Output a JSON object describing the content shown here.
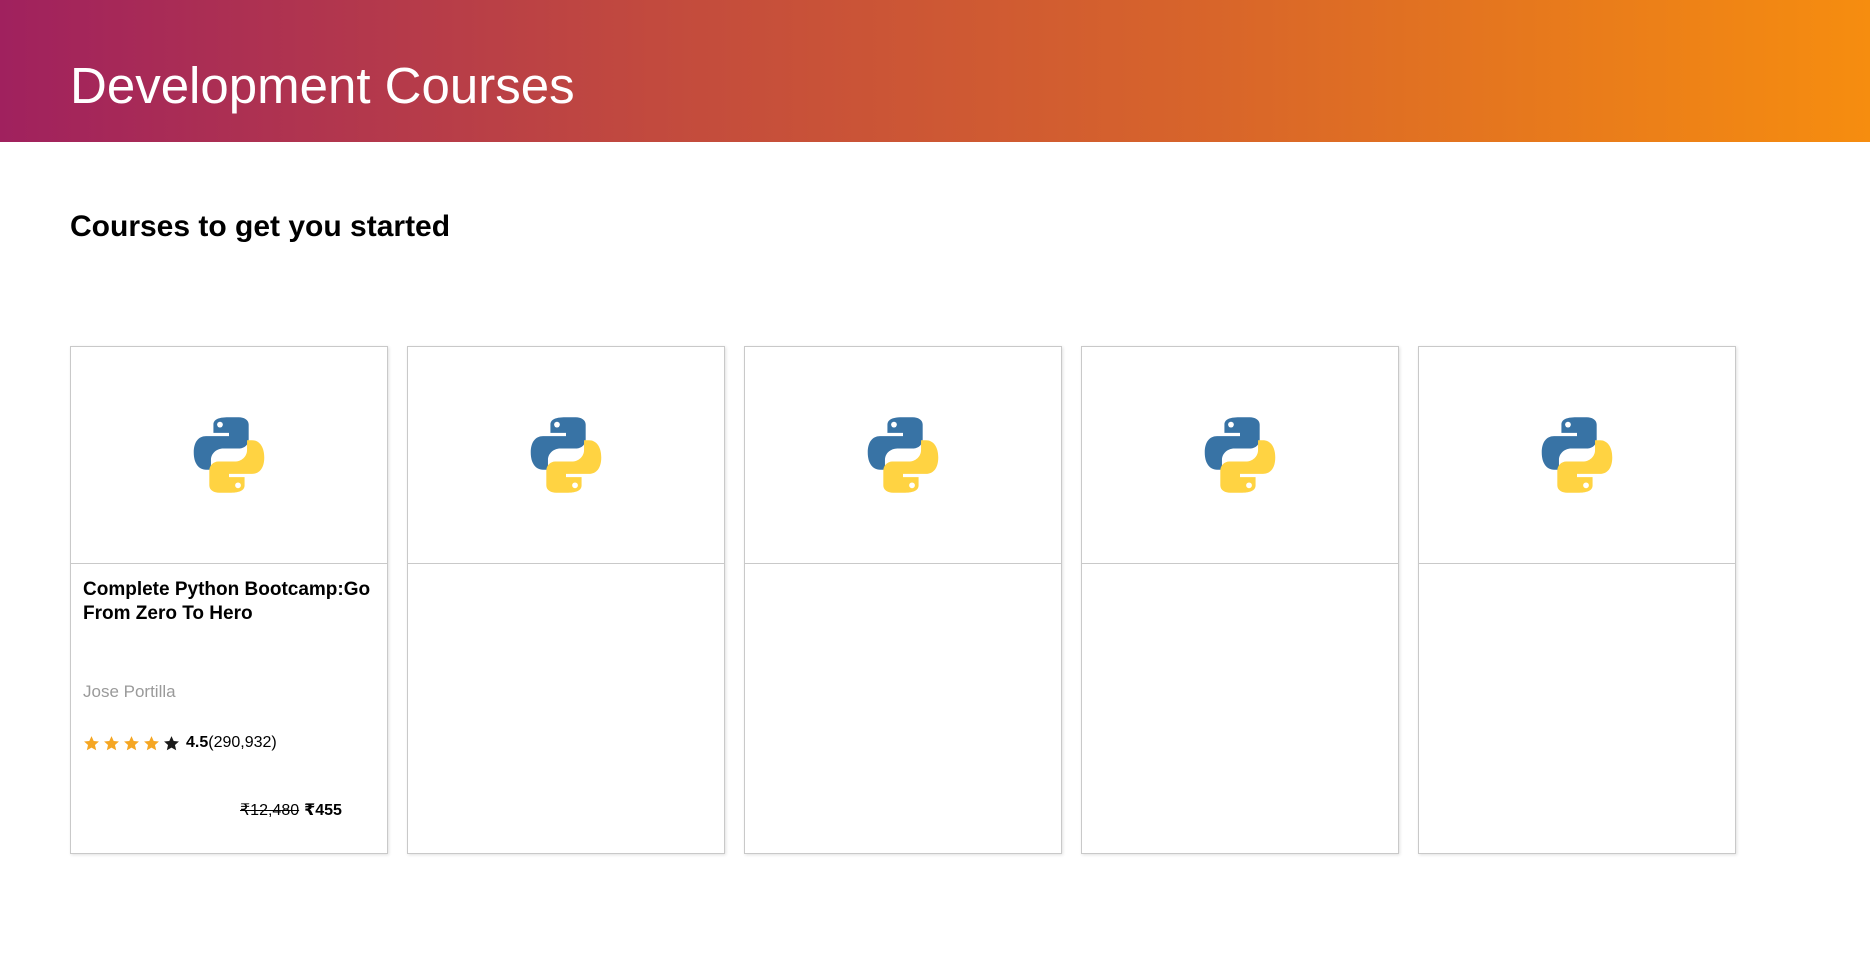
{
  "header": {
    "title": "Development Courses",
    "gradient": [
      "#a0215e",
      "#f68d0f"
    ]
  },
  "section": {
    "title": "Courses to get you started"
  },
  "courses": [
    {
      "icon": "python-logo-icon",
      "title": "Complete Python Bootcamp:Go From Zero To Hero",
      "author": "Jose Portilla",
      "rating": "4.5",
      "rating_count": "(290,932)",
      "stars_filled": 4,
      "stars_total": 5,
      "old_price": "₹12,480",
      "price": "₹455"
    },
    {
      "icon": "python-logo-icon"
    },
    {
      "icon": "python-logo-icon"
    },
    {
      "icon": "python-logo-icon"
    },
    {
      "icon": "python-logo-icon"
    }
  ],
  "colors": {
    "star_filled": "#f5a623",
    "star_empty": "#1a1a1a",
    "python_blue": "#3873a5",
    "python_yellow": "#ffd342"
  }
}
